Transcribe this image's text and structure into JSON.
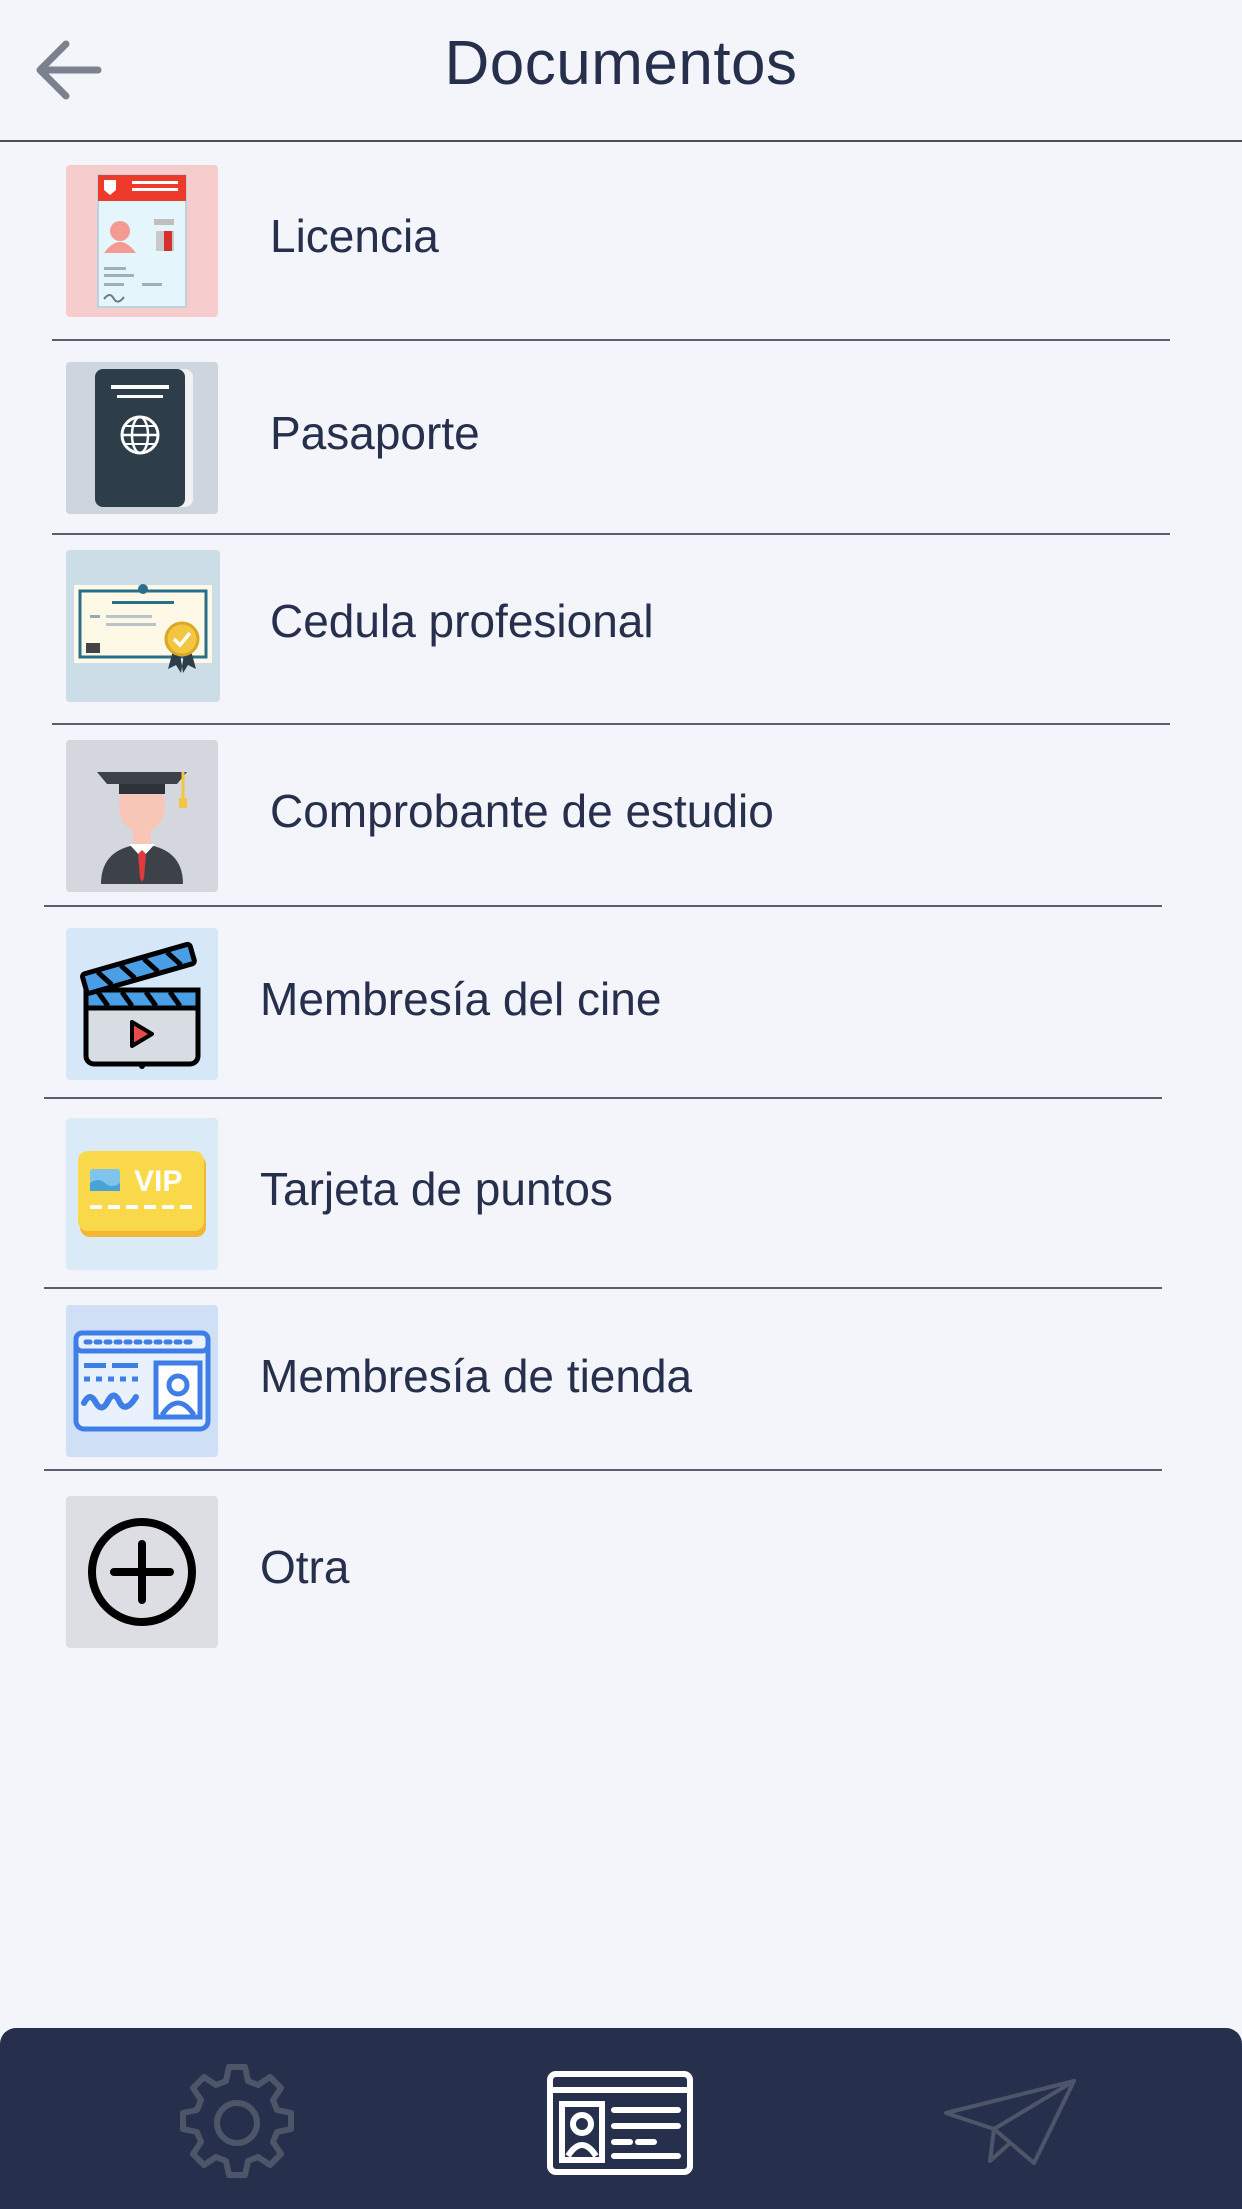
{
  "header": {
    "title": "Documentos",
    "back_icon": "arrow-left-icon"
  },
  "documents": [
    {
      "label": "Licencia",
      "icon": "license-card-icon",
      "tile_color": "#f6cccc"
    },
    {
      "label": "Pasaporte",
      "icon": "passport-icon",
      "tile_color": "#cfd5df"
    },
    {
      "label": "Cedula profesional",
      "icon": "certificate-icon",
      "tile_color": "#cddde8"
    },
    {
      "label": "Comprobante de estudio",
      "icon": "graduate-icon",
      "tile_color": "#d4d8de"
    },
    {
      "label": "Membresía del cine",
      "icon": "clapperboard-icon",
      "tile_color": "#d6e8f7"
    },
    {
      "label": "Tarjeta de puntos",
      "icon": "vip-card-icon",
      "tile_color": "#daeaf6"
    },
    {
      "label": "Membresía de tienda",
      "icon": "membership-card-icon",
      "tile_color": "#cfdff6"
    },
    {
      "label": "Otra",
      "icon": "plus-circle-icon",
      "tile_color": "#dcdee3"
    }
  ],
  "bottom_nav": [
    {
      "icon": "gear-icon",
      "active": false
    },
    {
      "icon": "id-card-icon",
      "active": true
    },
    {
      "icon": "paper-plane-icon",
      "active": false
    }
  ],
  "colors": {
    "background": "#f3f5fa",
    "text": "#26304d",
    "nav_bar": "#26304d"
  }
}
